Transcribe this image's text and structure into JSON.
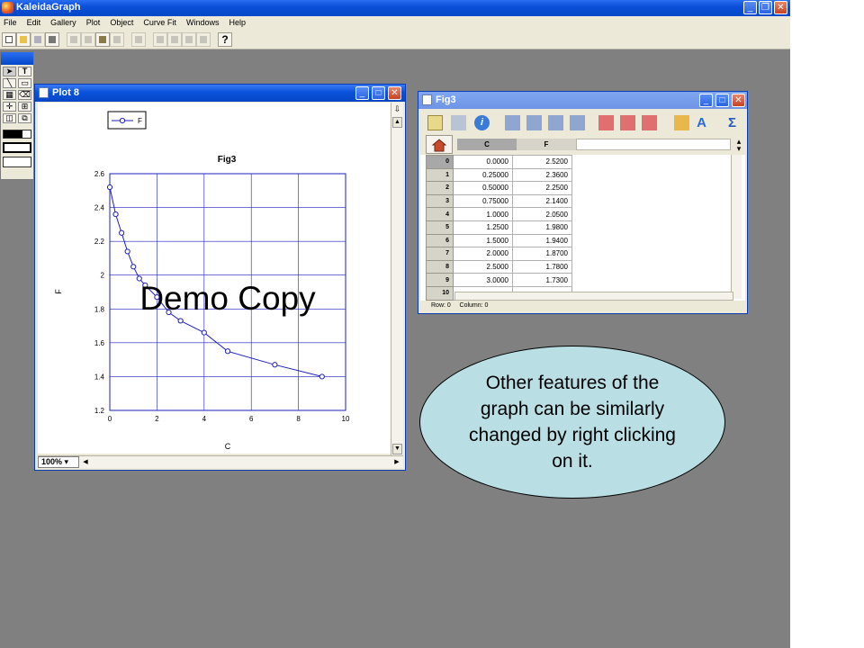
{
  "app": {
    "title": "KaleidaGraph",
    "menu": [
      "File",
      "Edit",
      "Gallery",
      "Plot",
      "Object",
      "Curve Fit",
      "Windows",
      "Help"
    ]
  },
  "plot_window": {
    "title": "Plot 8",
    "zoom": "100%",
    "watermark": "Demo Copy"
  },
  "chart_data": {
    "type": "line",
    "title": "Fig3",
    "xlabel": "C",
    "ylabel": "F",
    "xlim": [
      0,
      10
    ],
    "ylim": [
      1.2,
      2.6
    ],
    "x_ticks": [
      0,
      2,
      4,
      6,
      8,
      10
    ],
    "y_ticks": [
      1.2,
      1.4,
      1.6,
      1.8,
      2,
      2.2,
      2.4,
      2.6
    ],
    "grid": true,
    "legend": "top-left",
    "marker": "circle",
    "color": "#1f1fbf",
    "series": [
      {
        "name": "F",
        "x": [
          0,
          0.25,
          0.5,
          0.75,
          1.0,
          1.25,
          1.5,
          2.0,
          2.5,
          3.0,
          4.0,
          5.0,
          7.0,
          9.0
        ],
        "y": [
          2.52,
          2.36,
          2.25,
          2.14,
          2.05,
          1.98,
          1.94,
          1.87,
          1.78,
          1.73,
          1.66,
          1.55,
          1.47,
          1.4
        ]
      }
    ]
  },
  "data_window": {
    "title": "Fig3",
    "columns": [
      "C",
      "F"
    ],
    "rows": [
      {
        "n": "0",
        "c": "0.0000",
        "f": "2.5200"
      },
      {
        "n": "1",
        "c": "0.25000",
        "f": "2.3600"
      },
      {
        "n": "2",
        "c": "0.50000",
        "f": "2.2500"
      },
      {
        "n": "3",
        "c": "0.75000",
        "f": "2.1400"
      },
      {
        "n": "4",
        "c": "1.0000",
        "f": "2.0500"
      },
      {
        "n": "5",
        "c": "1.2500",
        "f": "1.9800"
      },
      {
        "n": "6",
        "c": "1.5000",
        "f": "1.9400"
      },
      {
        "n": "7",
        "c": "2.0000",
        "f": "1.8700"
      },
      {
        "n": "8",
        "c": "2.5000",
        "f": "1.7800"
      },
      {
        "n": "9",
        "c": "3.0000",
        "f": "1.7300"
      },
      {
        "n": "10",
        "c": "",
        "f": ""
      }
    ],
    "status_row": "Row: 0",
    "status_col": "Column: 0"
  },
  "callout": {
    "text": "Other features of the graph can be similarly changed by right clicking on it."
  }
}
